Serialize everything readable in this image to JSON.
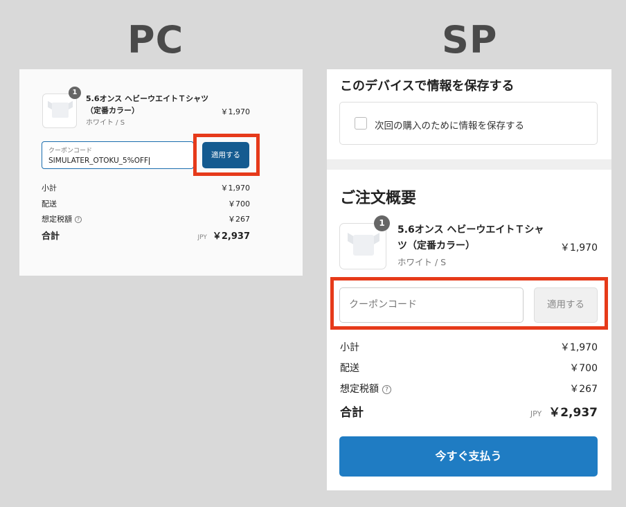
{
  "headings": {
    "pc": "PC",
    "sp": "SP"
  },
  "colors": {
    "accent_dark": "#155b90",
    "accent": "#1f7cc3",
    "highlight": "#e63a1a"
  },
  "pc": {
    "product": {
      "qty": "1",
      "name": "5.6オンス ヘビーウエイトＴシャツ（定番カラー）",
      "variant": "ホワイト / S",
      "price": "￥1,970",
      "image_icon": "tshirt-image"
    },
    "coupon": {
      "label": "クーポンコード",
      "value": "SIMULATER_OTOKU_5%OFF",
      "apply_label": "適用する"
    },
    "summary": {
      "subtotal_label": "小計",
      "subtotal": "￥1,970",
      "shipping_label": "配送",
      "shipping": "￥700",
      "tax_label": "想定税額",
      "tax": "￥267",
      "help_icon": "?",
      "total_label": "合計",
      "currency": "JPY",
      "total": "￥2,937"
    }
  },
  "sp": {
    "save": {
      "title": "このデバイスで情報を保存する",
      "checkbox_label": "次回の購入のために情報を保存する"
    },
    "order_summary_title": "ご注文概要",
    "product": {
      "qty": "1",
      "name": "5.6オンス ヘビーウエイトＴシャツ（定番カラー）",
      "variant": "ホワイト / S",
      "price": "￥1,970",
      "image_icon": "tshirt-image"
    },
    "coupon": {
      "placeholder": "クーポンコード",
      "apply_label": "適用する"
    },
    "summary": {
      "subtotal_label": "小計",
      "subtotal": "￥1,970",
      "shipping_label": "配送",
      "shipping": "￥700",
      "tax_label": "想定税額",
      "tax": "￥267",
      "help_icon": "?",
      "total_label": "合計",
      "currency": "JPY",
      "total": "￥2,937"
    },
    "pay_label": "今すぐ支払う"
  }
}
